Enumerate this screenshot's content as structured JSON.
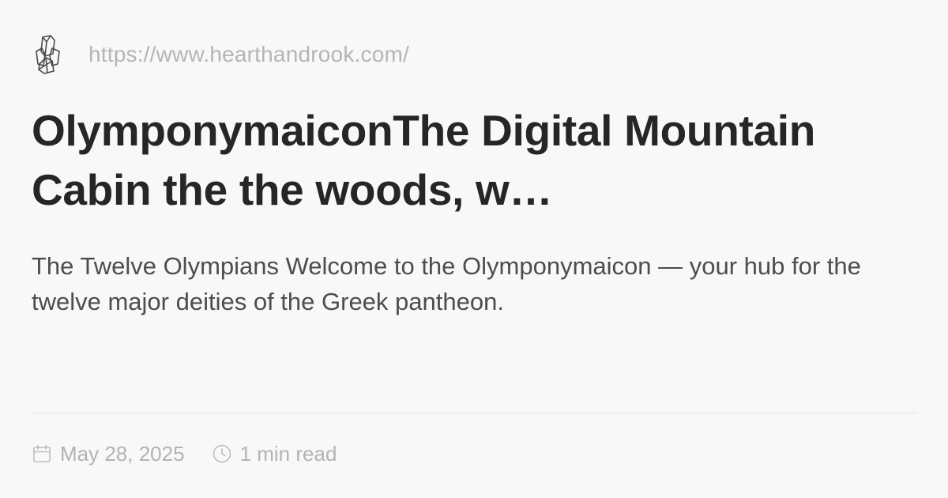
{
  "site": {
    "logo_icon": "crystal-cluster-icon",
    "url": "https://www.hearthandrook.com/"
  },
  "article": {
    "title": "OlymponymaiconThe Digital Mountain Cabin the the woods, w…",
    "description": "The Twelve Olympians Welcome to the Olymponymaicon — your hub for the twelve major deities of the Greek pantheon."
  },
  "meta": {
    "date_icon": "calendar-icon",
    "date": "May 28, 2025",
    "read_icon": "clock-icon",
    "read_time": "1 min read"
  },
  "colors": {
    "background": "#f9f8f8",
    "title": "#262626",
    "description": "#4d4d4d",
    "muted": "#b3b3b3",
    "divider": "#e5e4e4"
  }
}
